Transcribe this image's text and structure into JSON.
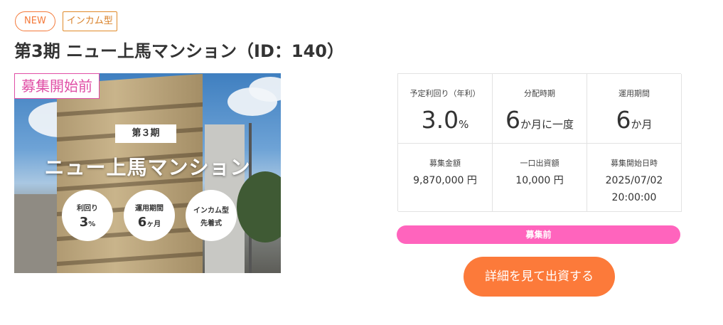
{
  "tags": {
    "new": "NEW",
    "type": "インカム型"
  },
  "title": "第3期 ニュー上馬マンション（ID：140）",
  "hero": {
    "badge": "募集開始前",
    "phase": "第３期",
    "name": "ニュー上馬マンション",
    "circles": [
      {
        "label": "利回り",
        "value": "3",
        "unit": "%"
      },
      {
        "label": "運用期間",
        "value": "6",
        "unit": "ヶ月"
      },
      {
        "label": "インカム型",
        "sub": "先着式"
      }
    ]
  },
  "stats": [
    {
      "label": "予定利回り（年利）",
      "value": "3.0",
      "unit": "%"
    },
    {
      "label": "分配時期",
      "value": "6",
      "unit": "か月に一度"
    },
    {
      "label": "運用期間",
      "value": "6",
      "unit": "か月"
    },
    {
      "label": "募集金額",
      "value": "9,870,000 円"
    },
    {
      "label": "一口出資額",
      "value": "10,000 円"
    },
    {
      "label": "募集開始日時",
      "value": "2025/07/02",
      "value2": "20:00:00"
    }
  ],
  "status": "募集前",
  "cta": "詳細を見て出資する"
}
